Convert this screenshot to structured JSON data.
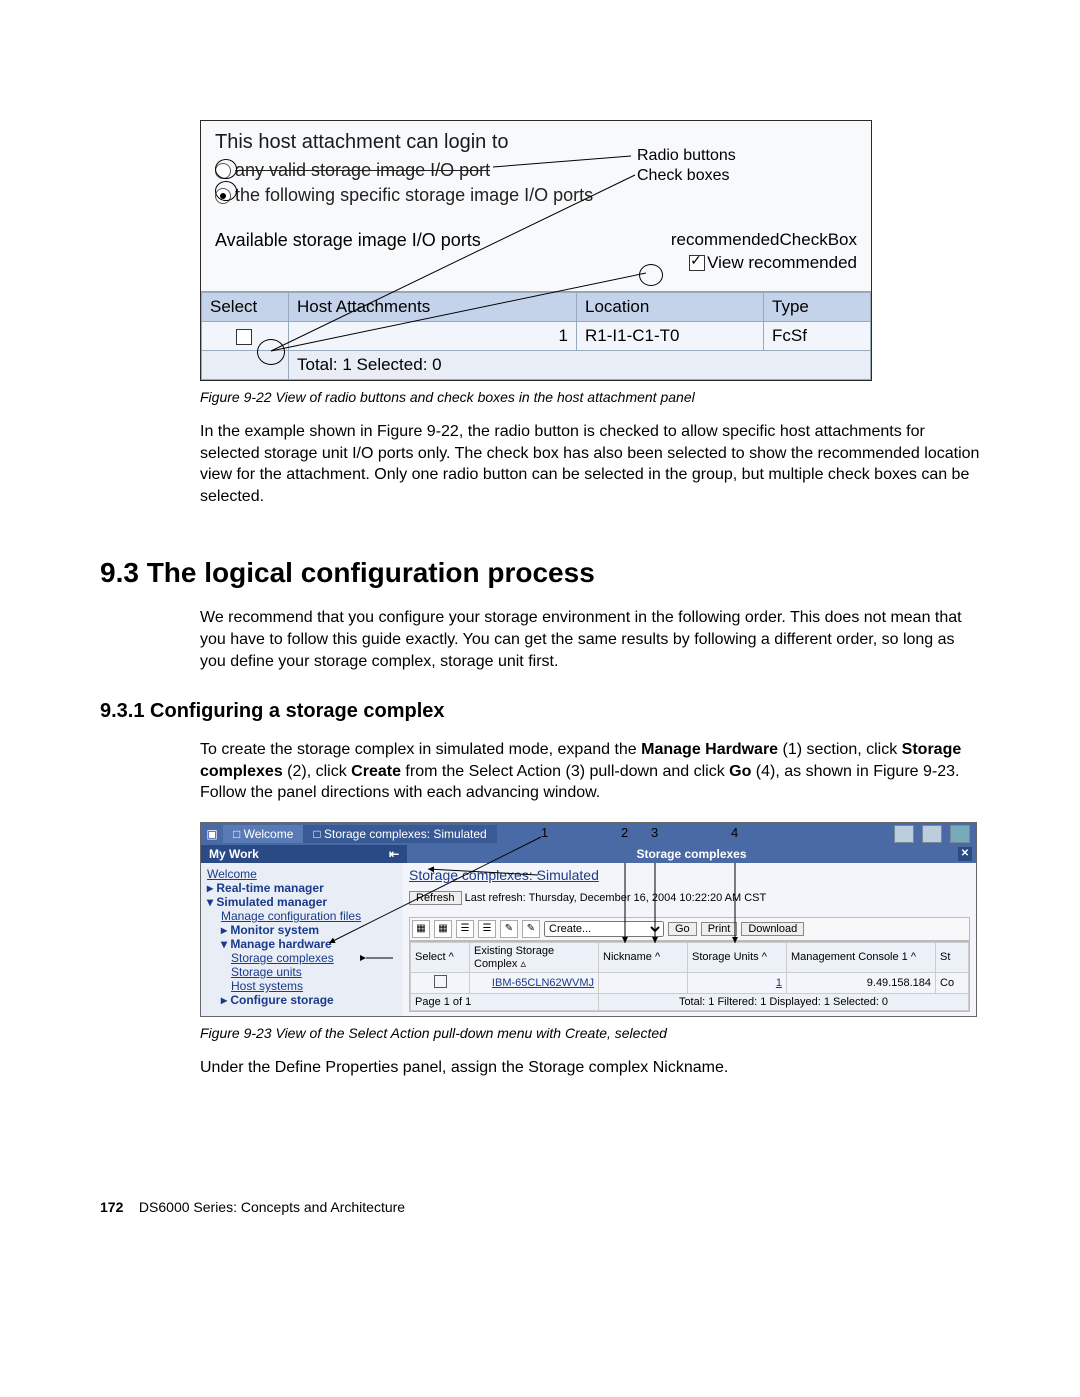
{
  "figure22": {
    "title": "This host attachment can login to",
    "radio1": "any valid storage image I/O port",
    "radio2": "the following specific storage image I/O ports",
    "avail_label": "Available storage image I/O ports",
    "rec_label1": "recommendedCheckBox",
    "rec_label2": "View recommended",
    "anno_radio": "Radio buttons",
    "anno_check": "Check boxes",
    "cols": {
      "select": "Select",
      "host": "Host Attachments",
      "loc": "Location",
      "type": "Type"
    },
    "row": {
      "num": "1",
      "loc": "R1-I1-C1-T0",
      "type": "FcSf"
    },
    "footer": "Total: 1    Selected: 0",
    "caption": "Figure 9-22   View of radio buttons and check boxes in the host attachment panel"
  },
  "para1": "In the example shown in Figure 9-22, the radio button is checked to allow specific host attachments for selected storage unit I/O ports only. The check box has also been selected to show the recommended location view for the attachment. Only one radio button can be selected in the group, but multiple check boxes can be selected.",
  "section": "9.3  The logical configuration process",
  "para2": "We recommend that you configure your storage environment in the following order. This does not mean that you have to follow this guide exactly. You can get the same results by following a different order, so long as you define your storage complex, storage unit first.",
  "subsection": "9.3.1  Configuring a storage complex",
  "para3a": "To create the storage complex in simulated mode, expand the ",
  "para3b": " (1) section, click ",
  "para3c": " (2), click ",
  "para3d": " from the Select Action (3) pull-down and click ",
  "para3e": " (4), as shown in Figure 9-23. Follow the panel directions with each advancing window.",
  "bold1": "Manage Hardware",
  "bold2": "Storage complexes",
  "bold3": "Create",
  "bold4": "Go",
  "figure23": {
    "tab_welcome": "Welcome",
    "tab_active": "Storage complexes: Simulated",
    "num1": "1",
    "num2": "2",
    "num3": "3",
    "num4": "4",
    "mywork": "My Work",
    "sc_bar": "Storage complexes",
    "nav": {
      "welcome": "Welcome",
      "rtm": "Real-time manager",
      "sim": "Simulated manager",
      "mcf": "Manage configuration files",
      "mon": "Monitor system",
      "mh": "Manage hardware",
      "sc": "Storage complexes",
      "su": "Storage units",
      "hs": "Host systems",
      "cs": "Configure storage"
    },
    "content_title": "Storage complexes: Simulated",
    "refresh_btn": "Refresh",
    "refresh_txt": "Last refresh: Thursday, December 16, 2004 10:22:20 AM CST",
    "select_val": "Create...",
    "go": "Go",
    "print": "Print",
    "download": "Download",
    "cols": {
      "select": "Select  ^",
      "esc": "Existing Storage Complex  ▵",
      "nick": "Nickname  ^",
      "su": "Storage Units  ^",
      "mc": "Management Console 1  ^",
      "st": "St"
    },
    "row": {
      "esc": "IBM-65CLN62WVMJ",
      "su": "1",
      "mc": "9.49.158.184",
      "st": "Co"
    },
    "status_left": "Page 1 of 1",
    "status_right": "Total: 1    Filtered: 1    Displayed: 1    Selected: 0",
    "caption": "Figure 9-23   View of the Select Action pull-down menu with Create, selected"
  },
  "para4": "Under the Define Properties panel, assign the Storage complex Nickname.",
  "footer": {
    "page": "172",
    "title": "DS6000 Series: Concepts and Architecture"
  }
}
